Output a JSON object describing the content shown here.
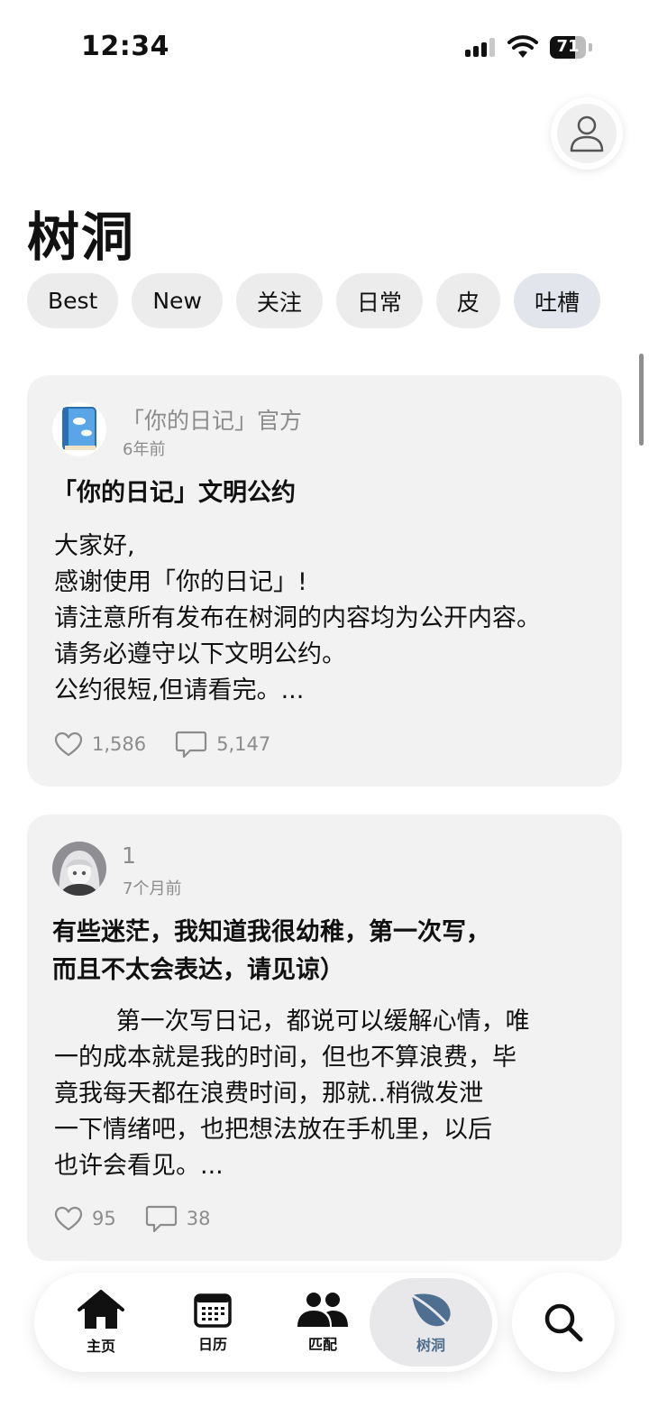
{
  "status_bar": {
    "time": "12:34",
    "battery": "71",
    "battery_level": 0.71
  },
  "header": {
    "title": "树洞",
    "profile_icon": "person-icon"
  },
  "tabs": [
    {
      "label": "Best",
      "active": false
    },
    {
      "label": "New",
      "active": false
    },
    {
      "label": "关注",
      "active": false
    },
    {
      "label": "日常",
      "active": false
    },
    {
      "label": "皮",
      "active": false
    },
    {
      "label": "吐槽",
      "active": true
    }
  ],
  "posts": [
    {
      "author": "「你的日记」官方",
      "time_ago": "6年前",
      "avatar_icon": "diary-book-icon",
      "title": "「你的日记」文明公约",
      "body": "大家好,\n感谢使用「你的日记」!\n请注意所有发布在树洞的内容均为公开内容。\n请务必遵守以下文明公约。\n公约很短,但请看完。...",
      "likes": "1,586",
      "comments": "5,147"
    },
    {
      "author": "1",
      "time_ago": "7个月前",
      "avatar_icon": "anime-girl-avatar",
      "title": "有些迷茫，我知道我很幼稚，第一次写，\n而且不太会表达，请见谅）",
      "body": "        第一次写日记，都说可以缓解心情，唯\n一的成本就是我的时间，但也不算浪费，毕\n竟我每天都在浪费时间，那就..稍微发泄\n一下情绪吧，也把想法放在手机里，以后\n也许会看见。...",
      "likes": "95",
      "comments": "38"
    }
  ],
  "nav": {
    "items": [
      {
        "label": "主页",
        "icon": "home-icon",
        "active": false
      },
      {
        "label": "日历",
        "icon": "calendar-icon",
        "active": false
      },
      {
        "label": "匹配",
        "icon": "people-icon",
        "active": false
      },
      {
        "label": "树洞",
        "icon": "leaf-icon",
        "active": true
      }
    ],
    "search_icon": "search-icon"
  },
  "colors": {
    "accent": "#4e6f8f",
    "card_bg": "#f2f2f3",
    "muted_text": "#8c8c8c"
  }
}
